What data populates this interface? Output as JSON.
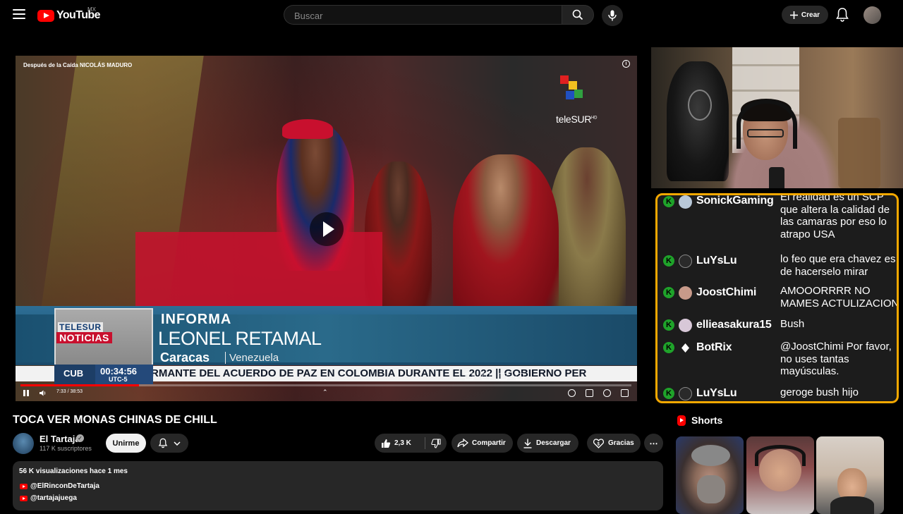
{
  "header": {
    "logo_text": "YouTube",
    "country_code": "MX",
    "search_placeholder": "Buscar",
    "create_label": "Crear"
  },
  "player": {
    "video_title_overlay": "Después de la Caída NICOLÁS MADURO",
    "channel_logo_text": "teleSUR",
    "channel_logo_hd": "HD",
    "news_brand_top": "TELESUR",
    "news_brand_bottom": "NOTICIAS",
    "lower_third_label": "INFORMA",
    "lower_third_name": "LEONEL RETAMAL",
    "lower_third_city": "Caracas",
    "lower_third_country": "Venezuela",
    "ticker_region": "CUB",
    "ticker_time": "00:34:56",
    "ticker_tz": "UTC-5",
    "ticker_text": "RMANTE DEL ACUERDO DE PAZ EN COLOMBIA DURANTE EL 2022  ||  GOBIERNO PER",
    "time_display": "7:33 / 38:53",
    "progress_fraction": 0.194
  },
  "chat": {
    "messages": [
      {
        "user": "SonickGaming",
        "text": "El realidad es un SCP que altera la calidad de las camaras por eso lo atrapo USA"
      },
      {
        "user": "LuYsLu",
        "text": "lo feo que era chavez es de hacerselo mirar"
      },
      {
        "user": "JoostChimi",
        "text": "AMOOORRRR NO MAMES ACTULIZACION"
      },
      {
        "user": "ellieasakura15",
        "text": "Bush"
      },
      {
        "user": "BotRix",
        "text": "@JoostChimi Por favor, no uses tantas mayúsculas."
      },
      {
        "user": "LuYsLu",
        "text": "geroge bush hijo"
      }
    ],
    "badge_letter": "K",
    "border_color": "#f5a800",
    "badge_color": "#1fa32a"
  },
  "video": {
    "title": "TOCA VER MONAS CHINAS DE CHILL",
    "channel_name": "El Tartaja",
    "subscribers": "117 K suscriptores",
    "join_label": "Unirme",
    "likes": "2,3 K",
    "share_label": "Compartir",
    "download_label": "Descargar",
    "thanks_label": "Gracias"
  },
  "description": {
    "meta": "56 K visualizaciones  hace 1 mes",
    "links": [
      "@ElRinconDeTartaja",
      "@tartajajuega"
    ]
  },
  "shorts": {
    "title": "Shorts"
  }
}
